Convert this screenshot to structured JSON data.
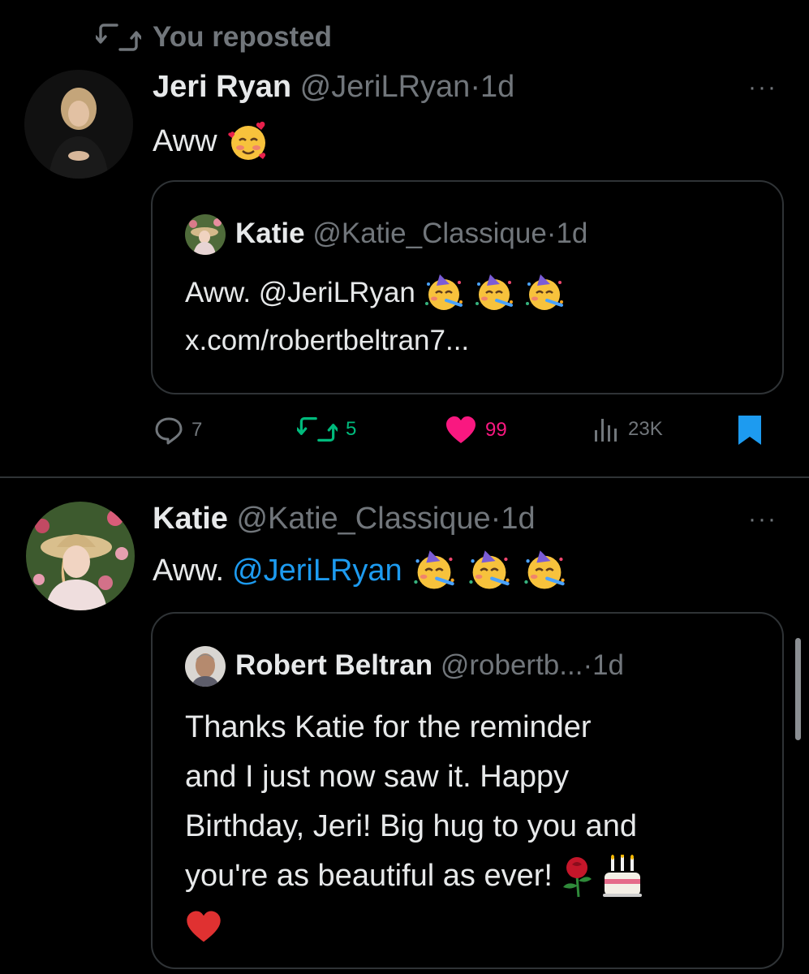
{
  "repost_banner": {
    "icon": "repost-icon",
    "text": "You reposted"
  },
  "tweet1": {
    "author_name": "Jeri Ryan",
    "handle": "@JeriLRyan",
    "separator": "·",
    "time": "1d",
    "text": "Aww",
    "more_label": "···",
    "quote": {
      "author_name": "Katie",
      "handle": "@Katie_Classique",
      "separator": "·",
      "time": "1d",
      "text_prefix": "Aww. @JeriLRyan",
      "link": "x.com/robertbeltran7..."
    },
    "actions": {
      "replies": "7",
      "reposts": "5",
      "likes": "99",
      "views": "23K"
    },
    "colors": {
      "repost": "#00ba7c",
      "like": "#f91880",
      "bookmark": "#1d9bf0"
    }
  },
  "tweet2": {
    "author_name": "Katie",
    "handle": "@Katie_Classique",
    "separator": "·",
    "time": "1d",
    "text_prefix": "Aww.",
    "mention": "@JeriLRyan",
    "more_label": "···",
    "quote": {
      "author_name": "Robert Beltran",
      "handle": "@robertb...",
      "separator": "·",
      "time": "1d",
      "lines": [
        "Thanks Katie for the reminder",
        "and I just now saw it. Happy",
        "Birthday, Jeri! Big hug to you and",
        "you're as beautiful as ever!"
      ]
    },
    "colors": {
      "mention": "#1d9bf0"
    }
  }
}
